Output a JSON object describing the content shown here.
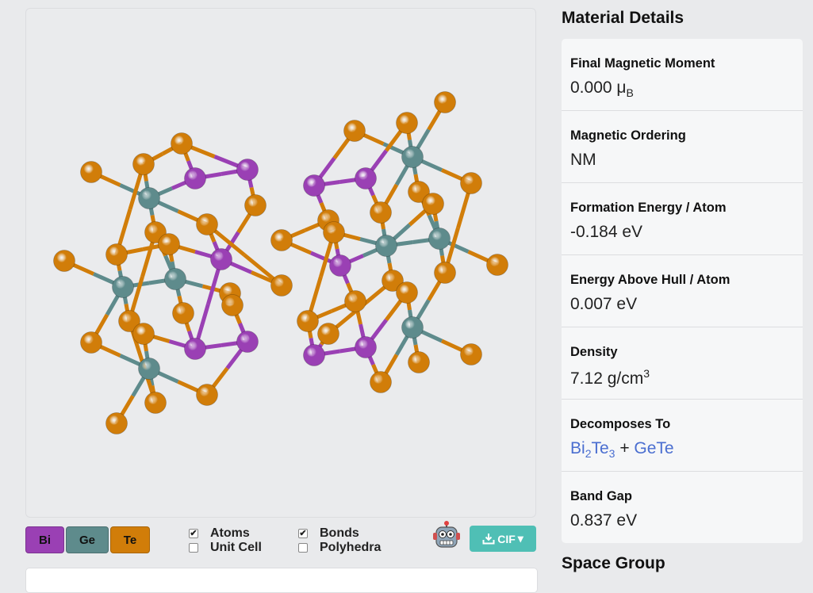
{
  "viewer": {
    "legend": [
      {
        "label": "Bi",
        "color": "#9a40b4"
      },
      {
        "label": "Ge",
        "color": "#5e8b8c"
      },
      {
        "label": "Te",
        "color": "#d17d09"
      }
    ],
    "options": [
      {
        "label": "Atoms",
        "checked": true
      },
      {
        "label": "Unit Cell",
        "checked": false
      },
      {
        "label": "Bonds",
        "checked": true
      },
      {
        "label": "Polyhedra",
        "checked": false
      }
    ],
    "download_label": "CIF",
    "check_mark": "✔",
    "dropdown_caret": "▾",
    "download_icon": "download-icon",
    "robot_icon": "robot-icon",
    "atom_colors": {
      "Bi": "#9a40b4",
      "Ge": "#5e8b8c",
      "Te": "#d17d09"
    }
  },
  "material_details": {
    "title": "Material Details",
    "properties": {
      "magnetic_moment": {
        "label": "Final Magnetic Moment",
        "value": "0.000",
        "unit": "μ",
        "unit_sub": "B"
      },
      "magnetic_ordering": {
        "label": "Magnetic Ordering",
        "value": "NM"
      },
      "formation_energy": {
        "label": "Formation Energy / Atom",
        "value": "-0.184 eV"
      },
      "energy_above_hull": {
        "label": "Energy Above Hull / Atom",
        "value": "0.007 eV"
      },
      "density": {
        "label": "Density",
        "value": "7.12 g/cm",
        "sup": "3"
      },
      "decomposes_to": {
        "label": "Decomposes To",
        "items": [
          {
            "base1": "Bi",
            "sub1": "2",
            "base2": "Te",
            "sub2": "3"
          },
          {
            "text": "GeTe"
          }
        ],
        "separator": "+"
      },
      "band_gap": {
        "label": "Band Gap",
        "value": "0.837 eV"
      }
    }
  },
  "space_group": {
    "title": "Space Group"
  }
}
